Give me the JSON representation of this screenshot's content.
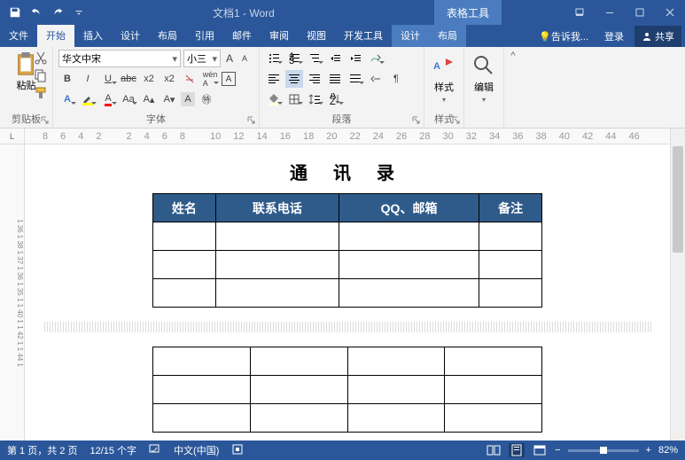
{
  "titlebar": {
    "doc_title": "文档1 - Word",
    "context_tab": "表格工具"
  },
  "tabs": {
    "file": "文件",
    "home": "开始",
    "insert": "插入",
    "design": "设计",
    "layout": "布局",
    "references": "引用",
    "mailings": "邮件",
    "review": "审阅",
    "view": "视图",
    "developer": "开发工具",
    "ctx_design": "设计",
    "ctx_layout": "布局",
    "tell": "告诉我...",
    "signin": "登录",
    "share": "共享"
  },
  "ribbon": {
    "clipboard": {
      "label": "剪贴板",
      "paste": "粘贴"
    },
    "font": {
      "label": "字体",
      "name": "华文中宋",
      "size": "小三"
    },
    "paragraph": {
      "label": "段落"
    },
    "styles": {
      "label": "样式",
      "btn": "样式"
    },
    "editing": {
      "label": "编辑",
      "btn": "编辑"
    }
  },
  "ruler": {
    "marks": [
      "8",
      "6",
      "4",
      "2",
      "",
      "2",
      "4",
      "6",
      "8",
      "",
      "10",
      "12",
      "14",
      "16",
      "18",
      "20",
      "22",
      "24",
      "26",
      "28",
      "30",
      "32",
      "34",
      "36",
      "38",
      "40",
      "42",
      "44",
      "46"
    ]
  },
  "document": {
    "title": "通 讯 录",
    "headers": [
      "姓名",
      "联系电话",
      "QQ、邮箱",
      "备注"
    ],
    "rows": 6
  },
  "statusbar": {
    "page": "第 1 页，共 2 页",
    "words": "12/15 个字",
    "lang": "中文(中国)",
    "zoom": "82%"
  },
  "vruler": "1 36 1 38 1 37 1 36 1 35 1        1 40 1     1 42 1    1 44 1"
}
